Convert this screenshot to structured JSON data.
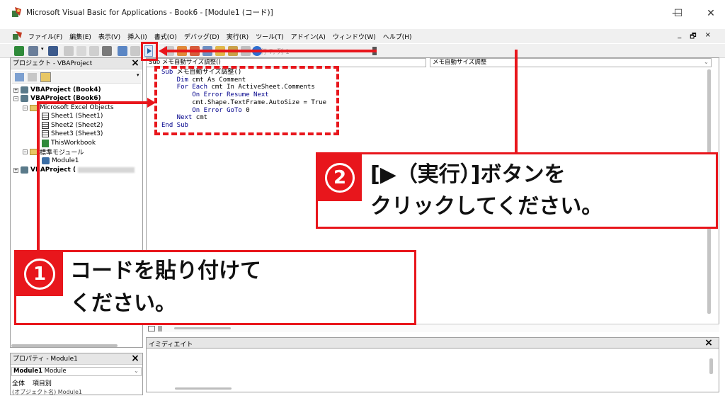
{
  "window": {
    "title": "Microsoft Visual Basic for Applications - Book6 - [Module1 (コード)]",
    "minimize": "—",
    "maximize": "☐",
    "close": "✕"
  },
  "menu": {
    "items": [
      "ファイル(F)",
      "編集(E)",
      "表示(V)",
      "挿入(I)",
      "書式(O)",
      "デバッグ(D)",
      "実行(R)",
      "ツール(T)",
      "アドイン(A)",
      "ウィンドウ(W)",
      "ヘルプ(H)"
    ],
    "mdi_min": "_",
    "mdi_restore": "🗗",
    "mdi_close": "×"
  },
  "toolbar": {
    "position": "行 7, 列 1"
  },
  "project_explorer": {
    "title": "プロジェクト - VBAProject",
    "close": "×",
    "items": {
      "proj1": "VBAProject (Book4)",
      "proj2": "VBAProject (Book6)",
      "folder_objects": "Microsoft Excel Objects",
      "sheet1": "Sheet1 (Sheet1)",
      "sheet2": "Sheet2 (Sheet2)",
      "sheet3": "Sheet3 (Sheet3)",
      "workbook": "ThisWorkbook",
      "folder_modules": "標準モジュール",
      "module1": "Module1",
      "proj3": "VBAProject ("
    }
  },
  "properties": {
    "title": "プロパティ - Module1",
    "close": "×",
    "object_name": "Module1",
    "object_type": "Module",
    "tab_all": "全体",
    "tab_category": "項目別",
    "row": "(オブジェクト名)  Module1"
  },
  "code_window": {
    "object_combo": "Sub メモ自動サイズ調整()",
    "proc_combo": "メモ自動サイズ調整",
    "lines": [
      {
        "kw": "Sub",
        "rest": " メモ自動サイズ調整()"
      },
      {
        "kw": "    Dim",
        "rest": " cmt As Comment"
      },
      {
        "kw": "    For Each",
        "rest": " cmt In ActiveSheet.Comments"
      },
      {
        "kw": "        On Error Resume Next",
        "rest": ""
      },
      {
        "kw": "",
        "rest": "        cmt.Shape.TextFrame.AutoSize = True"
      },
      {
        "kw": "        On Error GoTo",
        "rest": " 0"
      },
      {
        "kw": "    Next",
        "rest": " cmt"
      },
      {
        "kw": "End Sub",
        "rest": ""
      }
    ]
  },
  "immediate": {
    "title": "イミディエイト",
    "close": "×"
  },
  "callout1": {
    "number": "1",
    "line1": "コードを貼り付けて",
    "line2": "ください。"
  },
  "callout2": {
    "number": "2",
    "line1": "[▶（実行）]ボタンを",
    "line2": "クリックしてください。"
  },
  "colors": {
    "accent_red": "#e8161c",
    "keyword_blue": "#00008b"
  }
}
